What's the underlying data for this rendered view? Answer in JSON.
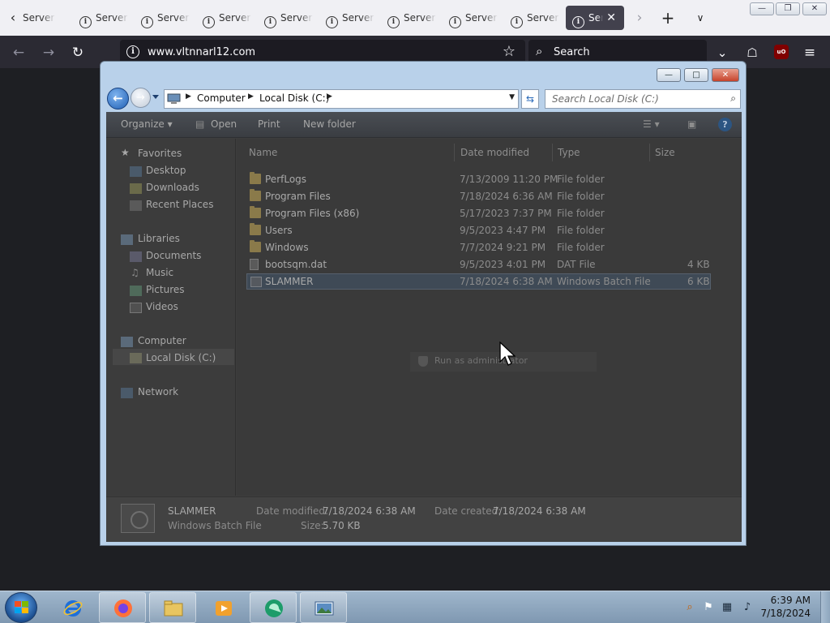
{
  "browser": {
    "tabs": [
      {
        "label": "Server"
      },
      {
        "label": "Server"
      },
      {
        "label": "Server"
      },
      {
        "label": "Server"
      },
      {
        "label": "Server"
      },
      {
        "label": "Server"
      },
      {
        "label": "Server"
      },
      {
        "label": "Server"
      },
      {
        "label": "Server"
      }
    ],
    "active_tab": {
      "label": "Ser"
    },
    "url": "www.vltnnarl12.com",
    "search_placeholder": "Search",
    "extension_badge": "uO"
  },
  "explorer": {
    "breadcrumb": [
      "Computer",
      "Local Disk (C:)"
    ],
    "search_placeholder": "Search Local Disk (C:)",
    "toolbar": {
      "organize": "Organize",
      "open": "Open",
      "print": "Print",
      "new_folder": "New folder"
    },
    "nav": {
      "favorites": "Favorites",
      "desktop": "Desktop",
      "downloads": "Downloads",
      "recent_places": "Recent Places",
      "libraries": "Libraries",
      "documents": "Documents",
      "music": "Music",
      "pictures": "Pictures",
      "videos": "Videos",
      "computer": "Computer",
      "local_disk": "Local Disk (C:)",
      "network": "Network"
    },
    "columns": {
      "name": "Name",
      "date_modified": "Date modified",
      "type": "Type",
      "size": "Size"
    },
    "files": [
      {
        "name": "PerfLogs",
        "date": "7/13/2009 11:20 PM",
        "type": "File folder",
        "size": "",
        "icon": "folder-icon"
      },
      {
        "name": "Program Files",
        "date": "7/18/2024 6:36 AM",
        "type": "File folder",
        "size": "",
        "icon": "folder-icon"
      },
      {
        "name": "Program Files (x86)",
        "date": "5/17/2023 7:37 PM",
        "type": "File folder",
        "size": "",
        "icon": "folder-icon"
      },
      {
        "name": "Users",
        "date": "9/5/2023 4:47 PM",
        "type": "File folder",
        "size": "",
        "icon": "folder-icon"
      },
      {
        "name": "Windows",
        "date": "7/7/2024 9:21 PM",
        "type": "File folder",
        "size": "",
        "icon": "folder-icon"
      },
      {
        "name": "bootsqm.dat",
        "date": "9/5/2023 4:01 PM",
        "type": "DAT File",
        "size": "4 KB",
        "icon": "file-icon"
      },
      {
        "name": "SLAMMER",
        "date": "7/18/2024 6:38 AM",
        "type": "Windows Batch File",
        "size": "6 KB",
        "icon": "batch-file-icon"
      }
    ],
    "context_menu": {
      "run_as_admin": "Run as administrator"
    },
    "details": {
      "name": "SLAMMER",
      "type": "Windows Batch File",
      "date_modified_label": "Date modified:",
      "date_modified": "7/18/2024 6:38 AM",
      "date_created_label": "Date created:",
      "date_created": "7/18/2024 6:38 AM",
      "size_label": "Size:",
      "size": "5.70 KB"
    }
  },
  "taskbar": {
    "time": "6:39 AM",
    "date": "7/18/2024"
  }
}
